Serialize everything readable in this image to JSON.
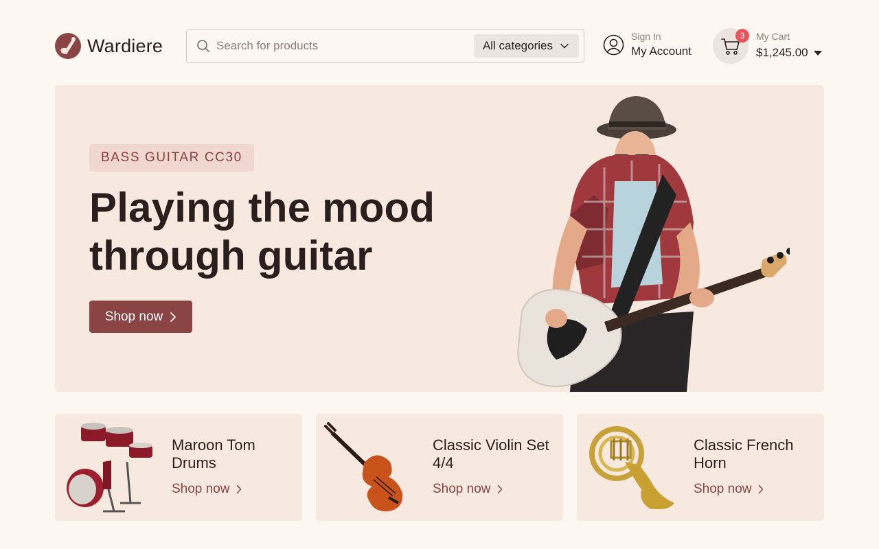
{
  "brand": {
    "name": "Wardiere"
  },
  "search": {
    "placeholder": "Search for products",
    "category": "All categories"
  },
  "account": {
    "small": "Sign In",
    "main": "My Account"
  },
  "cart": {
    "label": "My Cart",
    "total": "$1,245.00",
    "count": "3"
  },
  "hero": {
    "tag": "BASS GUITAR CC30",
    "title_line1": "Playing the mood",
    "title_line2": "through guitar",
    "button": "Shop now"
  },
  "products": [
    {
      "title": "Maroon Tom Drums",
      "link": "Shop now"
    },
    {
      "title": "Classic Violin Set 4/4",
      "link": "Shop now"
    },
    {
      "title": "Classic French Horn",
      "link": "Shop now"
    }
  ],
  "colors": {
    "accent": "#8b4444",
    "background": "#fdf7f2",
    "panel": "#f7e9e0",
    "badge": "#e9545c"
  },
  "icons": [
    "logo-icon",
    "search-icon",
    "chevron-down-icon",
    "user-icon",
    "cart-icon",
    "chevron-right-icon",
    "caret-down-icon"
  ]
}
